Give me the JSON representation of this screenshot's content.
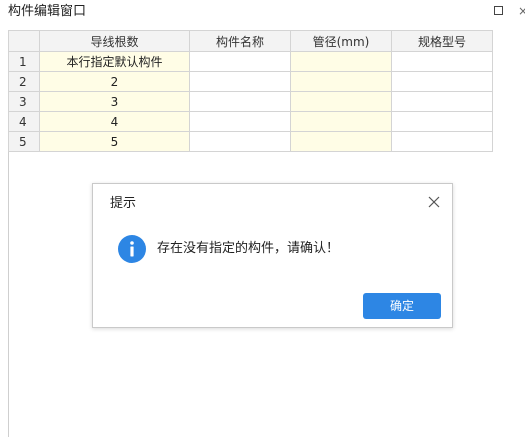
{
  "window": {
    "title": "构件编辑窗口"
  },
  "grid": {
    "headers": [
      "导线根数",
      "构件名称",
      "管径(mm)",
      "规格型号"
    ],
    "rows": [
      {
        "num": "1",
        "cells": [
          "本行指定默认构件",
          "",
          "",
          ""
        ]
      },
      {
        "num": "2",
        "cells": [
          "2",
          "",
          "",
          ""
        ]
      },
      {
        "num": "3",
        "cells": [
          "3",
          "",
          "",
          ""
        ]
      },
      {
        "num": "4",
        "cells": [
          "4",
          "",
          "",
          ""
        ]
      },
      {
        "num": "5",
        "cells": [
          "5",
          "",
          "",
          ""
        ]
      }
    ]
  },
  "dialog": {
    "title": "提示",
    "message": "存在没有指定的构件，请确认！",
    "ok_label": "确定",
    "icon": "info-icon",
    "accent": "#2d86e4"
  },
  "colors": {
    "editable_cell": "#fffde6",
    "header_bg": "#f3f3f3"
  }
}
